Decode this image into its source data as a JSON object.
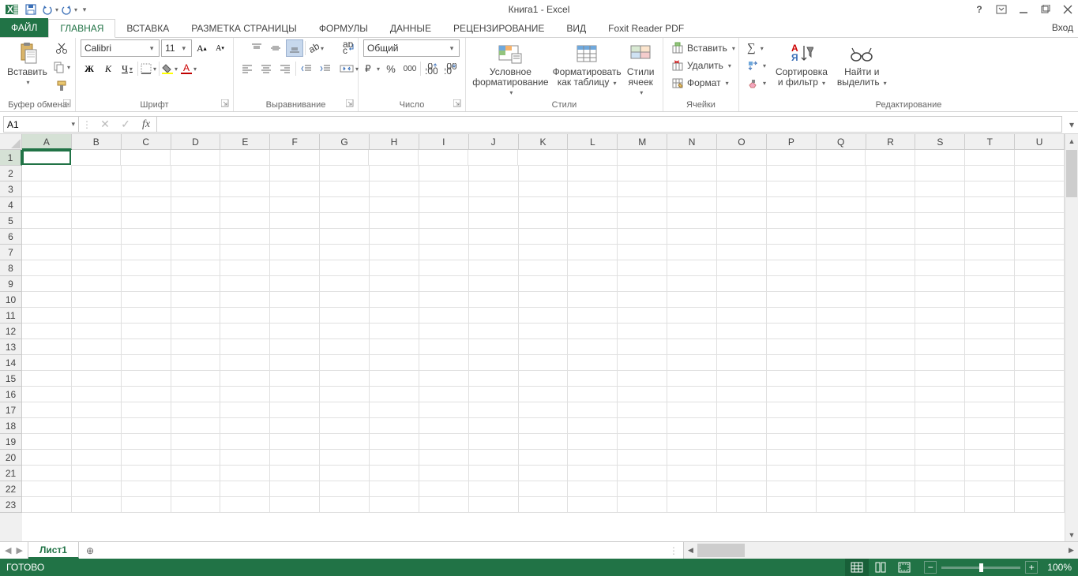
{
  "title": "Книга1 - Excel",
  "qat": {
    "save": "save",
    "undo": "undo",
    "redo": "redo"
  },
  "win": {
    "help": "?",
    "opts": "ribbon-opts",
    "min": "–",
    "max": "❐",
    "close": "✕"
  },
  "signin": "Вход",
  "tabs": {
    "file": "ФАЙЛ",
    "items": [
      "ГЛАВНАЯ",
      "ВСТАВКА",
      "РАЗМЕТКА СТРАНИЦЫ",
      "ФОРМУЛЫ",
      "ДАННЫЕ",
      "РЕЦЕНЗИРОВАНИЕ",
      "ВИД",
      "Foxit Reader PDF"
    ],
    "active": 0
  },
  "ribbon": {
    "clipboard": {
      "label": "Буфер обмена",
      "paste": "Вставить"
    },
    "font": {
      "label": "Шрифт",
      "name": "Calibri",
      "size": "11"
    },
    "align": {
      "label": "Выравнивание"
    },
    "number": {
      "label": "Число",
      "format": "Общий"
    },
    "styles": {
      "label": "Стили",
      "cond": "Условное",
      "cond2": "форматирование",
      "fmt": "Форматировать",
      "fmt2": "как таблицу",
      "cell": "Стили",
      "cell2": "ячеек"
    },
    "cells": {
      "label": "Ячейки",
      "insert": "Вставить",
      "delete": "Удалить",
      "format": "Формат"
    },
    "editing": {
      "label": "Редактирование",
      "sort": "Сортировка",
      "sort2": "и фильтр",
      "find": "Найти и",
      "find2": "выделить"
    }
  },
  "namebox": "A1",
  "columns": [
    "A",
    "B",
    "C",
    "D",
    "E",
    "F",
    "G",
    "H",
    "I",
    "J",
    "K",
    "L",
    "M",
    "N",
    "O",
    "P",
    "Q",
    "R",
    "S",
    "T",
    "U"
  ],
  "rows_count": 23,
  "sheet": {
    "name": "Лист1"
  },
  "status": {
    "ready": "ГОТОВО",
    "zoom": "100%"
  }
}
